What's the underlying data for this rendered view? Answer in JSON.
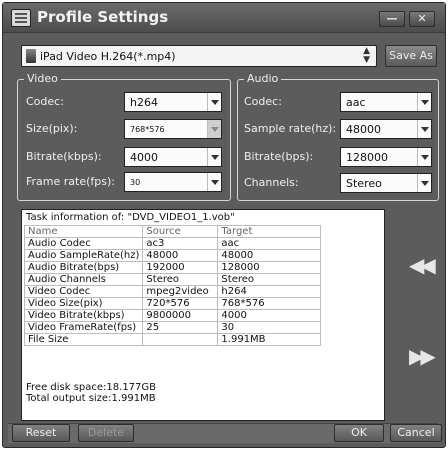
{
  "window": {
    "title": "Profile Settings",
    "minimize": "—",
    "close": "✕"
  },
  "profile": {
    "selected": "iPad Video H.264(*.mp4)",
    "save_as_label": "Save As"
  },
  "video": {
    "group_title": "Video",
    "codec_label": "Codec:",
    "codec_value": "h264",
    "size_label": "Size(pix):",
    "size_value": "768*576",
    "bitrate_label": "Bitrate(kbps):",
    "bitrate_value": "4000",
    "framerate_label": "Frame rate(fps):",
    "framerate_value": "30"
  },
  "audio": {
    "group_title": "Audio",
    "codec_label": "Codec:",
    "codec_value": "aac",
    "samplerate_label": "Sample rate(hz):",
    "samplerate_value": "48000",
    "bitrate_label": "Bitrate(bps):",
    "bitrate_value": "128000",
    "channels_label": "Channels:",
    "channels_value": "Stereo"
  },
  "task": {
    "header": "Task information of: \"DVD_VIDEO1_1.vob\"",
    "columns": [
      "Name",
      "Source",
      "Target"
    ],
    "rows": [
      [
        "Audio Codec",
        "ac3",
        "aac"
      ],
      [
        "Audio SampleRate(hz)",
        "48000",
        "48000"
      ],
      [
        "Audio Bitrate(bps)",
        "192000",
        "128000"
      ],
      [
        "Audio Channels",
        "Stereo",
        "Stereo"
      ],
      [
        "Video Codec",
        "mpeg2video",
        "h264"
      ],
      [
        "Video Size(pix)",
        "720*576",
        "768*576"
      ],
      [
        "Video Bitrate(kbps)",
        "9800000",
        "4000"
      ],
      [
        "Video FrameRate(fps)",
        "25",
        "30"
      ],
      [
        "File Size",
        "",
        "1.991MB"
      ]
    ],
    "free_disk": "Free disk space:18.177GB",
    "total_output": "Total output size:1.991MB"
  },
  "nav": {
    "prev": "◀◀",
    "next": "▶▶"
  },
  "buttons": {
    "reset": "Reset",
    "delete": "Delete",
    "ok": "OK",
    "cancel": "Cancel"
  }
}
